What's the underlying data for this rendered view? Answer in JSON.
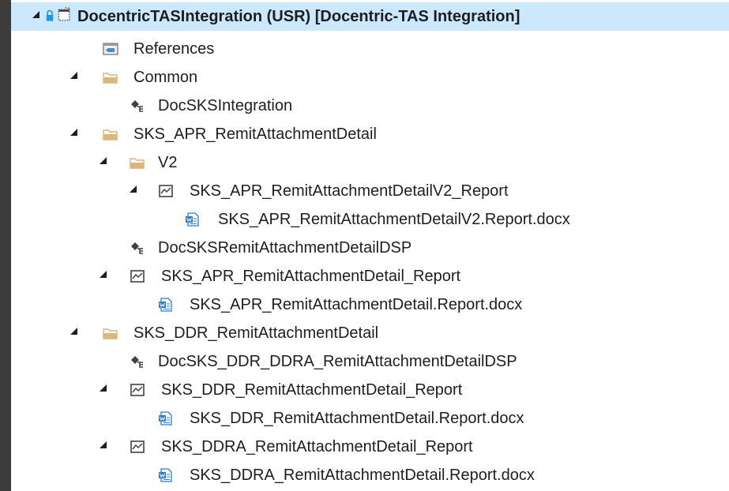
{
  "tree": {
    "items": [
      {
        "label": "DocentricTASIntegration (USR) [Docentric-TAS Integration]",
        "icon": "project-icon",
        "expanded": true,
        "selected": true
      },
      {
        "label": "References",
        "icon": "references-icon"
      },
      {
        "label": "Common",
        "icon": "folder-icon",
        "expanded": true
      },
      {
        "label": "DocSKSIntegration",
        "icon": "class-icon"
      },
      {
        "label": "SKS_APR_RemitAttachmentDetail",
        "icon": "folder-icon",
        "expanded": true
      },
      {
        "label": "V2",
        "icon": "folder-icon",
        "expanded": true
      },
      {
        "label": "SKS_APR_RemitAttachmentDetailV2_Report",
        "icon": "report-icon",
        "expanded": true
      },
      {
        "label": "SKS_APR_RemitAttachmentDetailV2.Report.docx",
        "icon": "docx-file-icon"
      },
      {
        "label": "DocSKSRemitAttachmentDetailDSP",
        "icon": "class-icon"
      },
      {
        "label": "SKS_APR_RemitAttachmentDetail_Report",
        "icon": "report-icon",
        "expanded": true
      },
      {
        "label": "SKS_APR_RemitAttachmentDetail.Report.docx",
        "icon": "docx-file-icon"
      },
      {
        "label": "SKS_DDR_RemitAttachmentDetail",
        "icon": "folder-icon",
        "expanded": true
      },
      {
        "label": "DocSKS_DDR_DDRA_RemitAttachmentDetailDSP",
        "icon": "class-icon"
      },
      {
        "label": "SKS_DDR_RemitAttachmentDetail_Report",
        "icon": "report-icon",
        "expanded": true
      },
      {
        "label": "SKS_DDR_RemitAttachmentDetail.Report.docx",
        "icon": "docx-file-icon"
      },
      {
        "label": "SKS_DDRA_RemitAttachmentDetail_Report",
        "icon": "report-icon",
        "expanded": true
      },
      {
        "label": "SKS_DDRA_RemitAttachmentDetail.Report.docx",
        "icon": "docx-file-icon"
      }
    ]
  },
  "colors": {
    "selection": "#cce8ff",
    "folder": "#dcb67a",
    "left_bar": "#3c3c3c",
    "lock": "#1c97ea",
    "docx": "#2b7cd3"
  }
}
